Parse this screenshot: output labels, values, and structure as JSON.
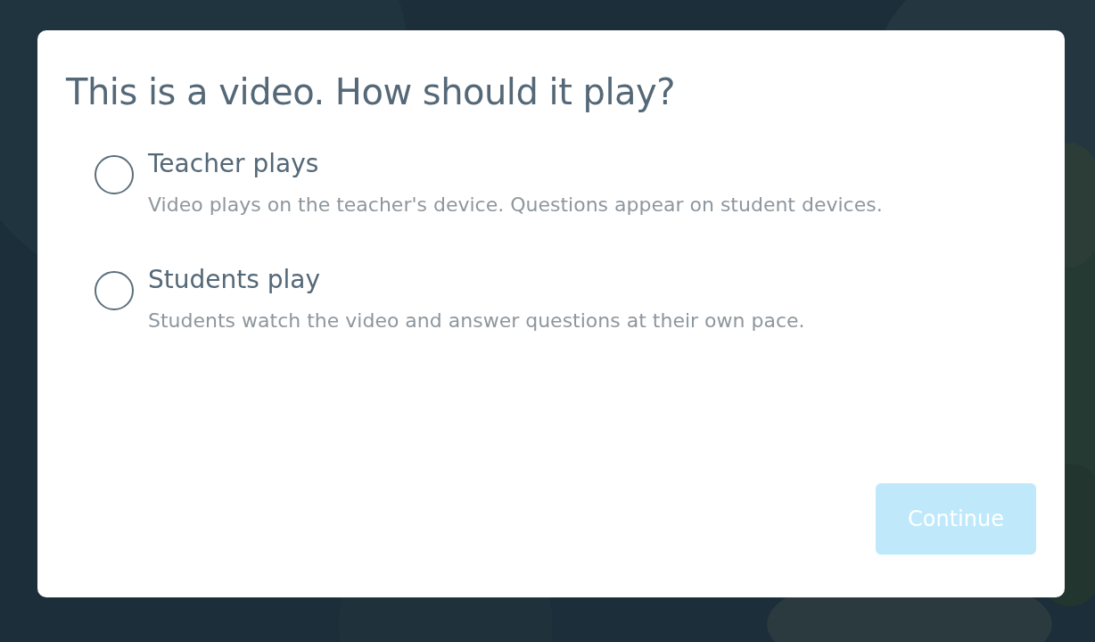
{
  "dialog": {
    "title": "This is a video. How should it play?",
    "options": [
      {
        "label": "Teacher plays",
        "description": "Video plays on the teacher's device. Questions appear on student devices.",
        "selected": false
      },
      {
        "label": "Students play",
        "description": "Students watch the video and answer questions at their own pace.",
        "selected": false
      }
    ],
    "continue_button": {
      "label": "Continue",
      "disabled": true
    }
  }
}
